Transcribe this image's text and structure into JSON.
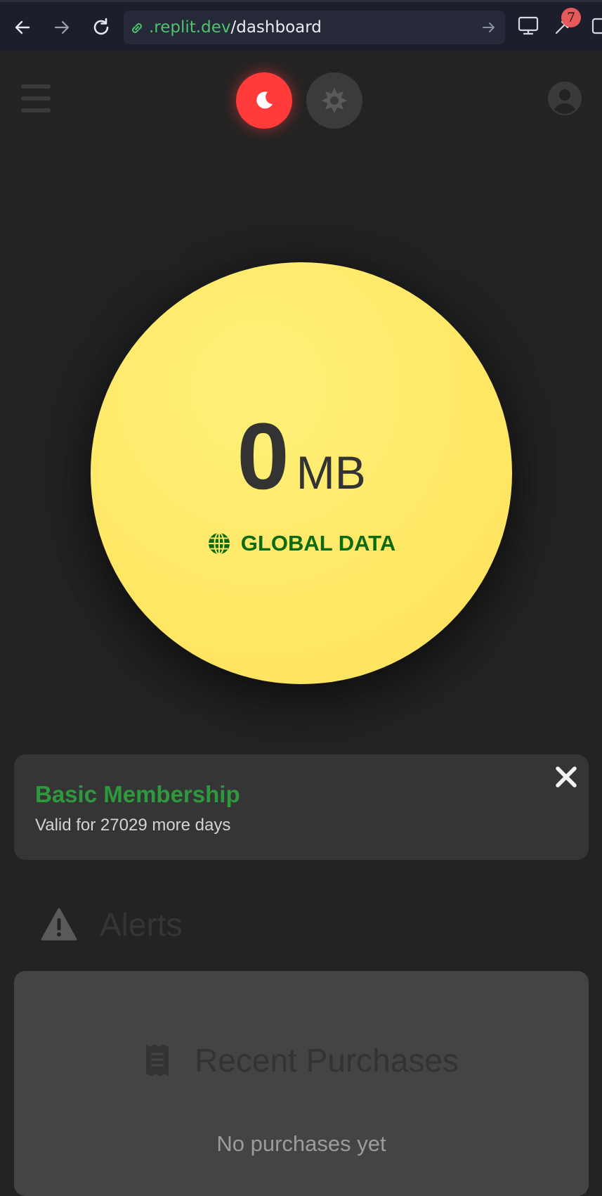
{
  "browser": {
    "url_domain": ".replit.dev",
    "url_path": "/dashboard",
    "extension_badge": "7"
  },
  "theme": {
    "active": "dark",
    "dark_color": "#ff3b3b",
    "accent_yellow": "#ffe866"
  },
  "data_meter": {
    "value": "0",
    "unit": "MB",
    "label": "GLOBAL DATA",
    "label_color": "#0d6b0d"
  },
  "membership": {
    "title": "Basic Membership",
    "subtitle": "Valid for 27029 more days",
    "title_color": "#2e9a3e"
  },
  "alerts": {
    "title": "Alerts"
  },
  "purchases": {
    "title": "Recent Purchases",
    "empty_text": "No purchases yet"
  },
  "icons": {
    "back": "arrow-left-icon",
    "forward": "arrow-right-icon",
    "reload": "reload-icon",
    "link": "link-icon",
    "menu": "hamburger-icon",
    "dark_mode": "moon-icon",
    "light_mode": "sun-icon",
    "profile": "user-icon",
    "globe": "globe-icon",
    "close": "close-icon",
    "warning": "warning-icon",
    "receipt": "receipt-icon"
  }
}
